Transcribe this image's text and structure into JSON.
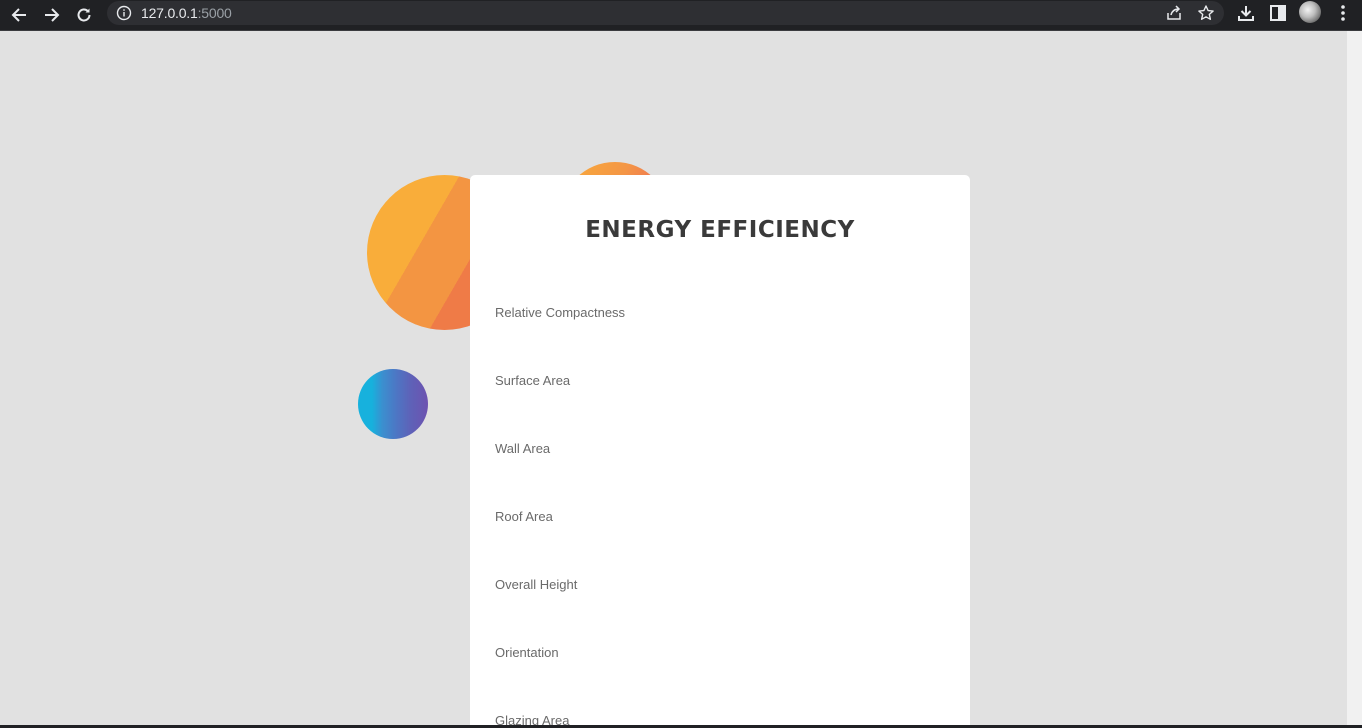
{
  "browser": {
    "url_host": "127.0.0.1",
    "url_port": ":5000"
  },
  "page": {
    "title": "ENERGY EFFICIENCY",
    "fields": [
      {
        "label": "Relative Compactness"
      },
      {
        "label": "Surface Area"
      },
      {
        "label": "Wall Area"
      },
      {
        "label": "Roof Area"
      },
      {
        "label": "Overall Height"
      },
      {
        "label": "Orientation"
      },
      {
        "label": "Glazing Area"
      }
    ]
  },
  "colors": {
    "background": "#e1e1e1",
    "card": "#ffffff",
    "orange": "#f39542",
    "blue": "#17b1dd",
    "purple": "#6d52b0"
  },
  "icons": [
    "back-arrow-icon",
    "forward-arrow-icon",
    "reload-icon",
    "info-icon",
    "share-icon",
    "star-icon",
    "download-icon",
    "side-panel-icon",
    "more-menu-icon"
  ]
}
